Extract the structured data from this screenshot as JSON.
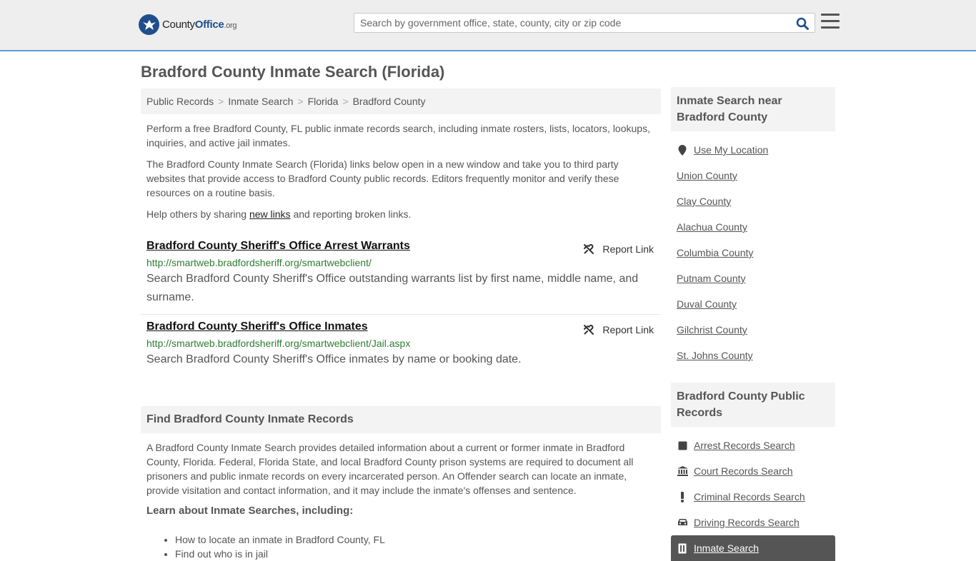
{
  "header": {
    "logo": {
      "prefix": "County",
      "brand": "Office",
      "tld": ".org"
    },
    "search_placeholder": "Search by government office, state, county, city or zip code",
    "search_icon": "search-icon",
    "menu_icon": "hamburger-menu-icon"
  },
  "page": {
    "title": "Bradford County Inmate Search (Florida)"
  },
  "breadcrumb": [
    "Public Records",
    "Inmate Search",
    "Florida",
    "Bradford County"
  ],
  "intro": {
    "p1": "Perform a free Bradford County, FL public inmate records search, including inmate rosters, lists, locators, lookups, inquiries, and active jail inmates.",
    "p2": "The Bradford County Inmate Search (Florida) links below open in a new window and take you to third party websites that provide access to Bradford County public records. Editors frequently monitor and verify these resources on a routine basis.",
    "p3_before": "Help others by sharing ",
    "p3_link": "new links",
    "p3_after": " and reporting broken links."
  },
  "links": [
    {
      "title": "Bradford County Sheriff's Office Arrest Warrants",
      "url": "http://smartweb.bradfordsheriff.org/smartwebclient/",
      "desc": "Search Bradford County Sheriff's Office outstanding warrants list by first name, middle name, and surname.",
      "report_label": "Report Link"
    },
    {
      "title": "Bradford County Sheriff's Office Inmates",
      "url": "http://smartweb.bradfordsheriff.org/smartwebclient/Jail.aspx",
      "desc": "Search Bradford County Sheriff's Office inmates by name or booking date.",
      "report_label": "Report Link"
    }
  ],
  "find_section": {
    "heading": "Find Bradford County Inmate Records",
    "body": "A Bradford County Inmate Search provides detailed information about a current or former inmate in Bradford County, Florida. Federal, Florida State, and local Bradford County prison systems are required to document all prisoners and public inmate records on every incarcerated person. An Offender search can locate an inmate, provide visitation and contact information, and it may include the inmate's offenses and sentence.",
    "learn_heading": "Learn about Inmate Searches, including:",
    "bullets": [
      "How to locate an inmate in Bradford County, FL",
      "Find out who is in jail"
    ]
  },
  "sidebar": {
    "nearby_heading": "Inmate Search near Bradford County",
    "use_location": "Use My Location",
    "nearby": [
      "Union County",
      "Clay County",
      "Alachua County",
      "Columbia County",
      "Putnam County",
      "Duval County",
      "Gilchrist County",
      "St. Johns County"
    ],
    "records_heading": "Bradford County Public Records",
    "records": [
      {
        "label": "Arrest Records Search",
        "icon": "square-icon"
      },
      {
        "label": "Court Records Search",
        "icon": "courthouse-icon"
      },
      {
        "label": "Criminal Records Search",
        "icon": "exclamation-icon"
      },
      {
        "label": "Driving Records Search",
        "icon": "car-icon"
      },
      {
        "label": "Inmate Search",
        "icon": "inmate-icon"
      }
    ]
  },
  "colors": {
    "accent_border": "#5b9bd5",
    "url_green": "#2e7d32",
    "active_sidebar": "#555555"
  }
}
